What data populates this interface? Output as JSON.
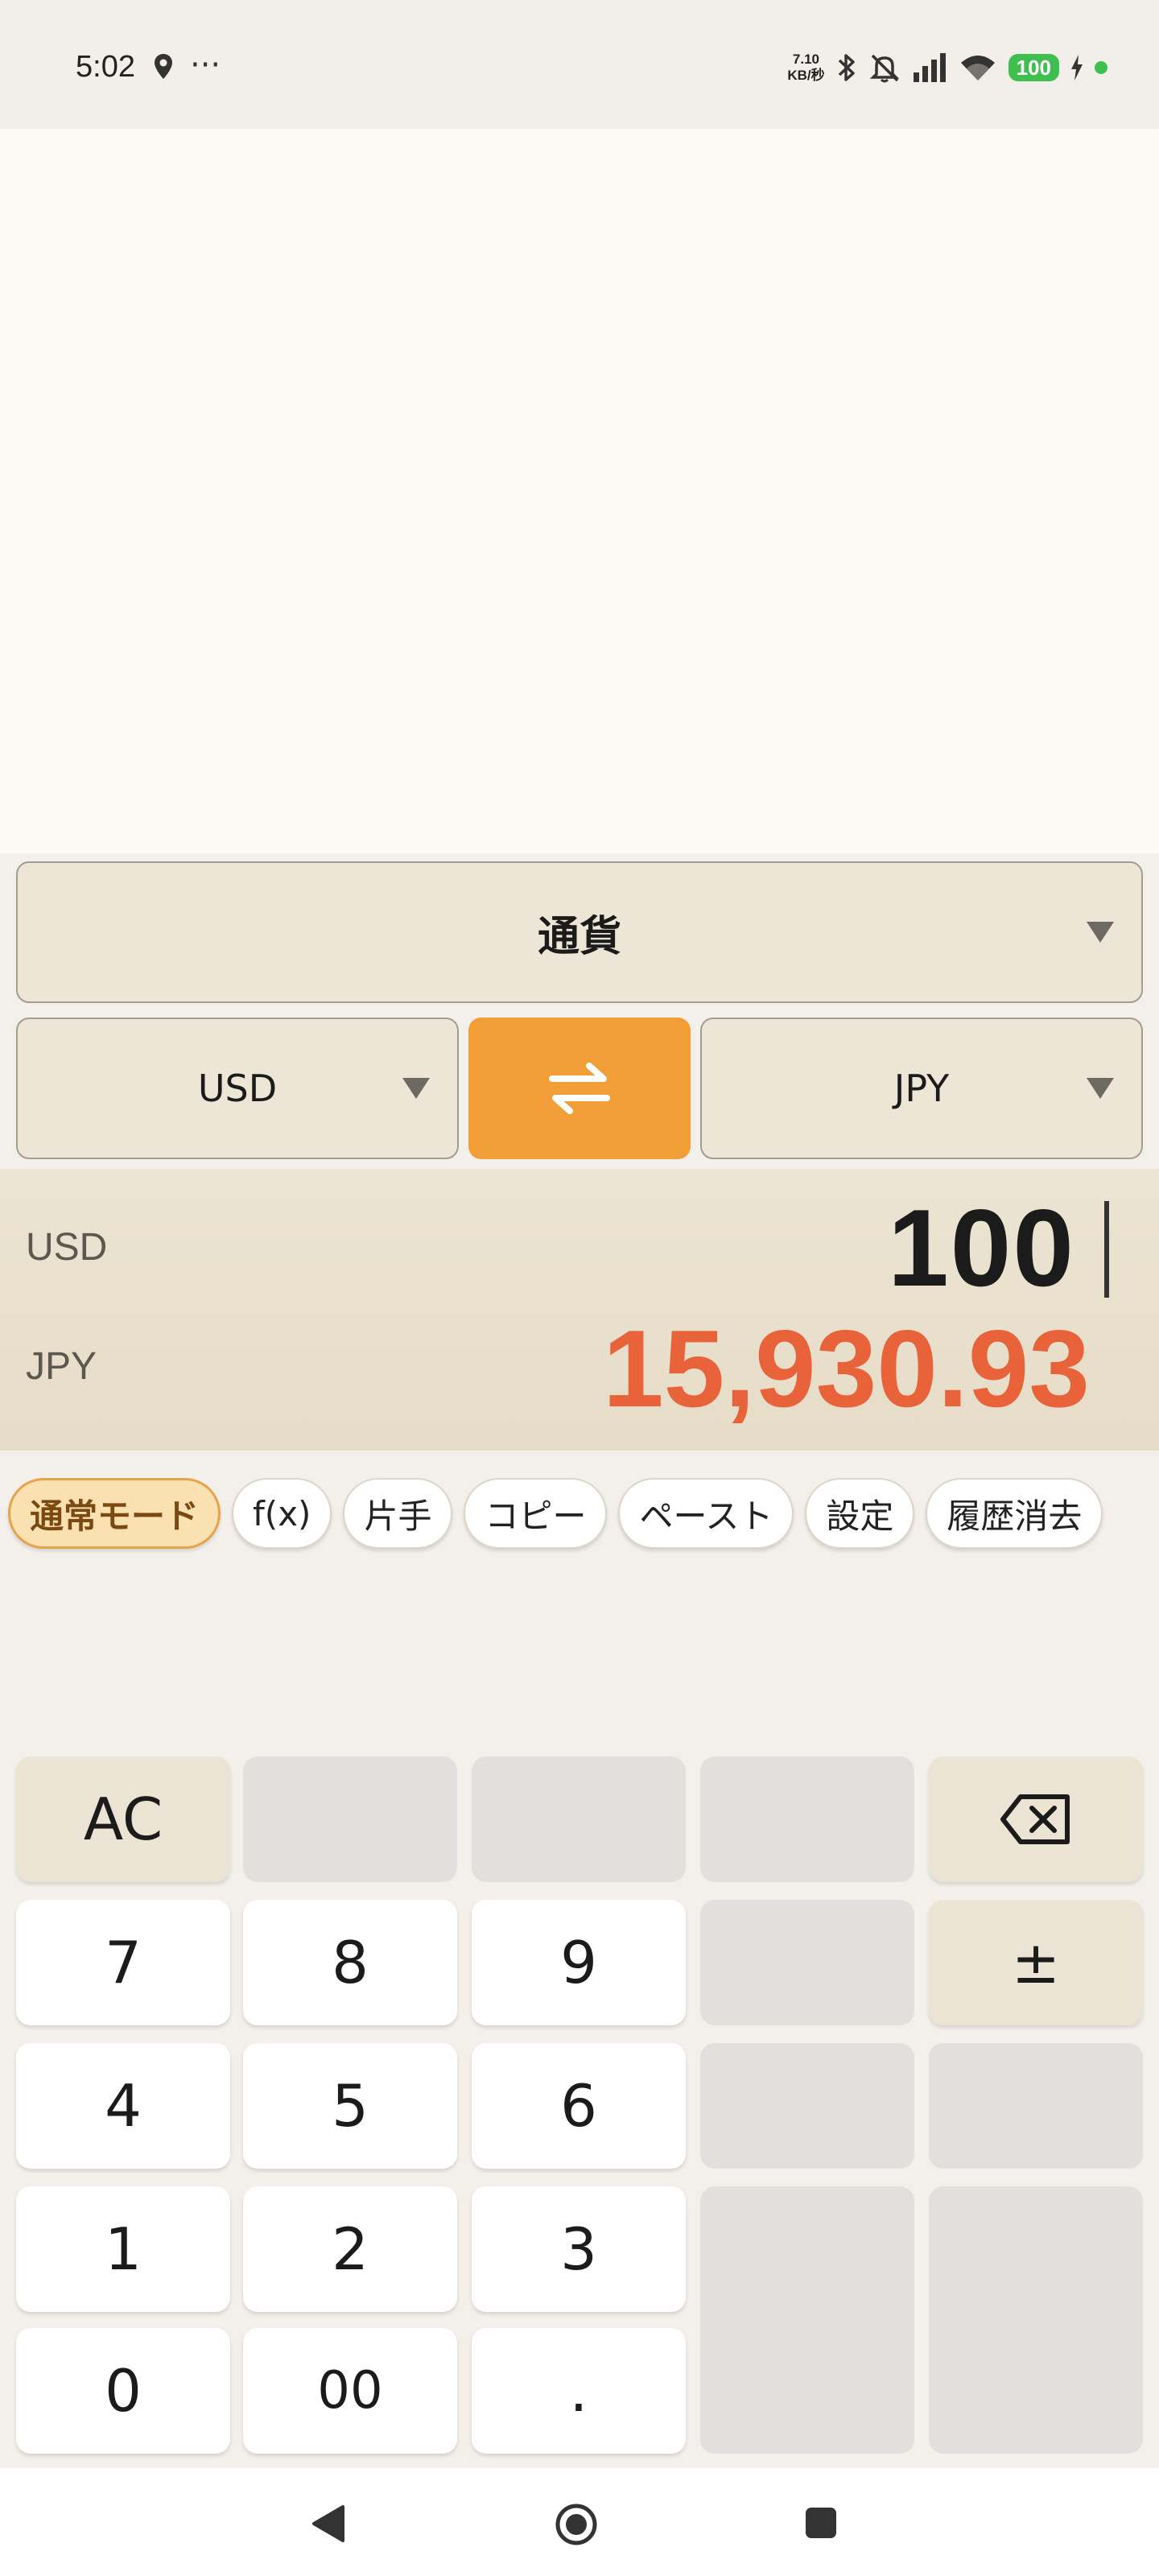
{
  "status_bar": {
    "time": "5:02",
    "more": "···",
    "net_speed_value": "7.10",
    "net_speed_unit": "KB/秒",
    "battery": "100",
    "icons": [
      "location-icon",
      "bluetooth-icon",
      "mute-icon",
      "signal-icon",
      "wifi-icon",
      "charging-icon"
    ]
  },
  "converter": {
    "category": "通貨",
    "from_currency": "USD",
    "to_currency": "JPY",
    "swap_icon": "swap-arrows-icon"
  },
  "display": {
    "from_label": "USD",
    "input_value": "100",
    "to_label": "JPY",
    "result_value": "15,930.93"
  },
  "chips": [
    "通常モード",
    "f(x)",
    "片手",
    "コピー",
    "ペースト",
    "設定",
    "履歴消去"
  ],
  "keypad": {
    "clear": "AC",
    "backspace_icon": "backspace-icon",
    "plus_minus": "±",
    "digits": [
      "7",
      "8",
      "9",
      "4",
      "5",
      "6",
      "1",
      "2",
      "3",
      "0",
      "00",
      "."
    ]
  },
  "nav": [
    "back-icon",
    "home-icon",
    "recents-icon"
  ],
  "colors": {
    "accent": "#f29e38",
    "result": "#e8623a",
    "active_chip": "#fbe1b2"
  }
}
